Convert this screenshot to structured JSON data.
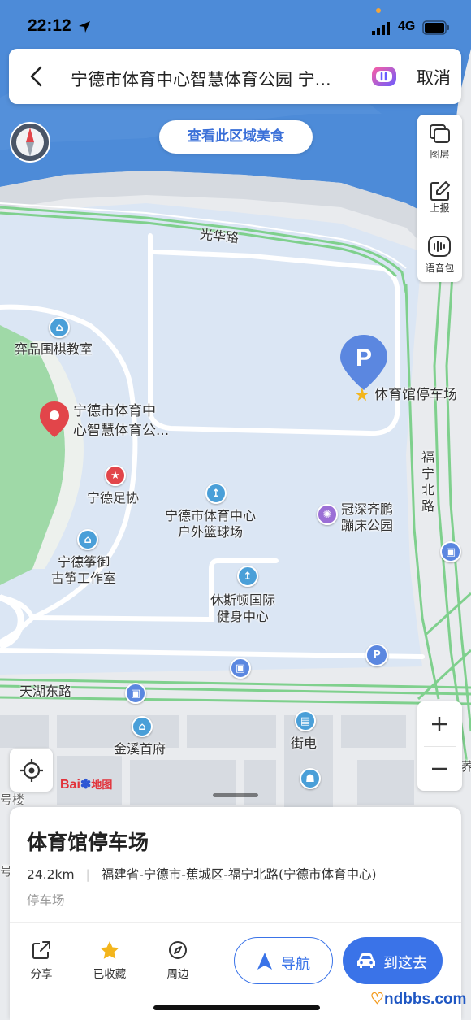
{
  "status_bar": {
    "time": "22:12",
    "network": "4G"
  },
  "search": {
    "query": "宁德市体育中心智慧体育公园 宁...",
    "cancel_label": "取消"
  },
  "food_pill": "查看此区域美食",
  "tools": {
    "layers": "图层",
    "report": "上报",
    "voice": "语音包"
  },
  "map_labels": {
    "road_guanghua": "光华路",
    "road_futing_north": "福宁北路",
    "road_tianhu_east": "天湖东路",
    "poi_weiqi": "弈品围棋教室",
    "poi_center_line1": "宁德市体育中",
    "poi_center_line2": "心智慧体育公...",
    "poi_football": "宁德足协",
    "poi_basketball_line1": "宁德市体育中心",
    "poi_basketball_line2": "户外篮球场",
    "poi_trampoline_line1": "冠深齐鹏",
    "poi_trampoline_line2": "蹦床公园",
    "poi_zheng_line1": "宁德筝御",
    "poi_zheng_line2": "古筝工作室",
    "poi_gym_line1": "休斯顿国际",
    "poi_gym_line2": "健身中心",
    "poi_parking_selected": "体育馆停车场",
    "poi_jinxi": "金溪首府",
    "poi_jiedian": "街电",
    "edge_hao_lou": "号楼",
    "edge_hao": "号",
    "edge_edge_r": "荞",
    "parking_letter": "P",
    "logo_bai": "Bai",
    "logo_ditu": "地图"
  },
  "place": {
    "name": "体育馆停车场",
    "distance": "24.2km",
    "address": "福建省-宁德市-蕉城区-福宁北路(宁德市体育中心)",
    "category": "停车场"
  },
  "actions": {
    "share": "分享",
    "saved": "已收藏",
    "nearby": "周边"
  },
  "buttons": {
    "navigate": "导航",
    "go_here": "到这去"
  },
  "watermark": "ndbbs.com",
  "colors": {
    "water": "#4d8bd8",
    "land": "#e9ebee",
    "park": "#dbe6f4",
    "road_green": "#7fd08d",
    "accent_blue": "#3a73e8",
    "pin_red": "#e2454a"
  }
}
